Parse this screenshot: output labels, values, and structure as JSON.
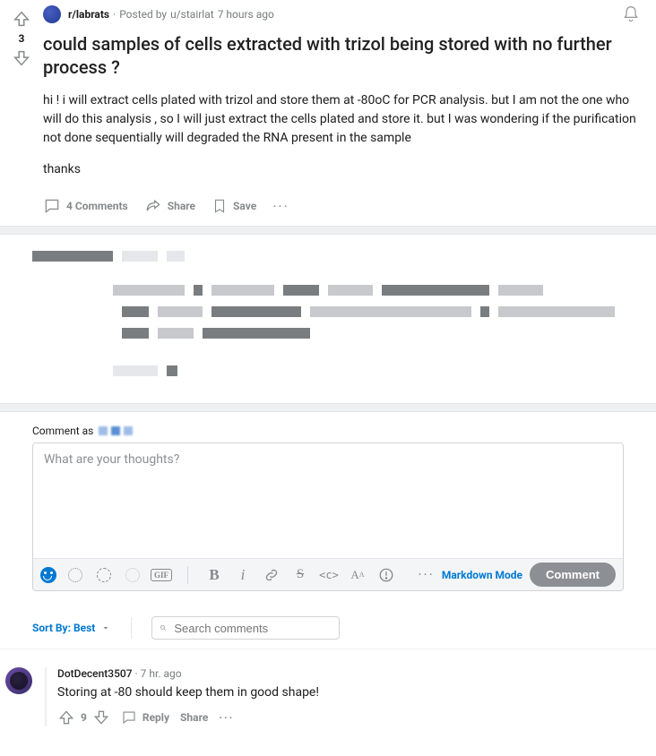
{
  "post": {
    "subreddit": "r/labrats",
    "posted_by_prefix": "Posted by",
    "author": "u/stairlat",
    "age": "7 hours ago",
    "score": "3",
    "title": "could samples of cells extracted with trizol being stored with no further process ?",
    "body_p1": "hi ! i will extract cells plated with trizol and store them at -80oC for PCR analysis. but I am not the one who will do this analysis , so I will just extract the cells plated and store it. but I was wondering if the purification not done sequentially will degraded the RNA present in the sample",
    "body_p2": "thanks",
    "comments_label": "4 Comments",
    "share_label": "Share",
    "save_label": "Save"
  },
  "comment_box": {
    "label": "Comment as",
    "placeholder": "What are your thoughts?",
    "markdown_mode": "Markdown Mode",
    "submit": "Comment"
  },
  "sort": {
    "label": "Sort By: Best",
    "search_placeholder": "Search comments"
  },
  "comments": [
    {
      "author": "DotDecent3507",
      "age": "7 hr. ago",
      "text": "Storing at -80 should keep them in good shape!",
      "score": "9",
      "reply": "Reply",
      "share": "Share"
    }
  ]
}
